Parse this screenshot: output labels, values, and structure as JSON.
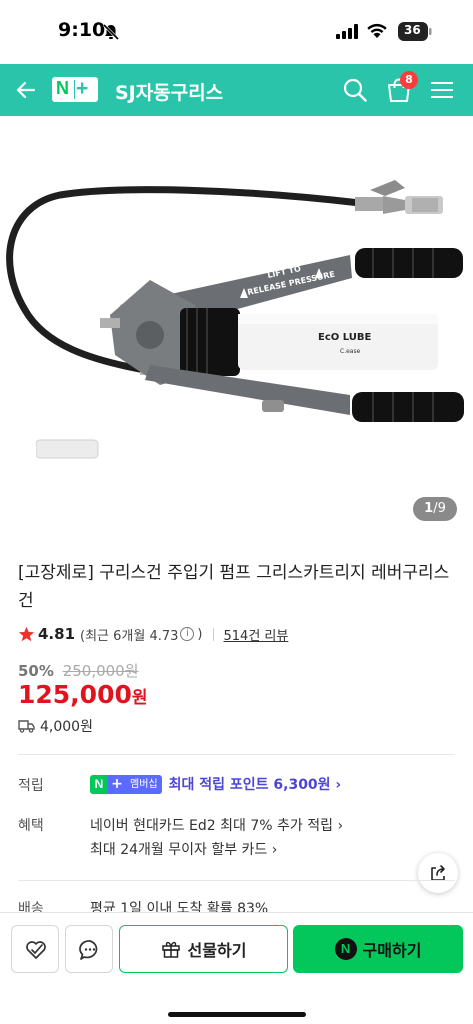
{
  "status_bar": {
    "time": "9:10",
    "battery": "36"
  },
  "header": {
    "logo_n": "N",
    "logo_plus": "+",
    "store_name": "SJ자동구리스",
    "cart_count": "8",
    "background_color": "#29c4a9"
  },
  "gallery": {
    "current": "1",
    "total": "9",
    "separator": "/",
    "image_label_brand": "EcO LUBE",
    "image_label_sub": "C.ease",
    "image_text_lift": "LIFT TO",
    "image_text_release": "RELEASE PRESSURE"
  },
  "product": {
    "title": "[고장제로] 구리스건 주입기 펌프 그리스카트리지 레버구리스건",
    "rating": "4.81",
    "recent_rating_prefix": "(최근 6개월 4.73",
    "recent_rating_suffix": ")",
    "info_icon": "i",
    "review_count": "514건 리뷰",
    "discount_rate": "50%",
    "original_price": "250,000원",
    "price": "125,000",
    "price_unit": "원",
    "shipping_fee": "4,000원",
    "price_color": "#e0131e"
  },
  "info": {
    "points_label": "적립",
    "membership_badge": "멤버십",
    "points_text": "최대 적립 포인트 6,300원 ›",
    "benefits_label": "혜택",
    "benefit_1": "네이버 현대카드 Ed2 최대 7% 추가 적립 ›",
    "benefit_2": "최대 24개월 무이자 할부 카드 ›",
    "delivery_label": "배송",
    "delivery_text": "평균 1일 이내 도착 확률 83%"
  },
  "actions": {
    "gift_label": "선물하기",
    "buy_label": "구매하기",
    "buy_icon_letter": "N",
    "accent_color": "#03c75a"
  }
}
